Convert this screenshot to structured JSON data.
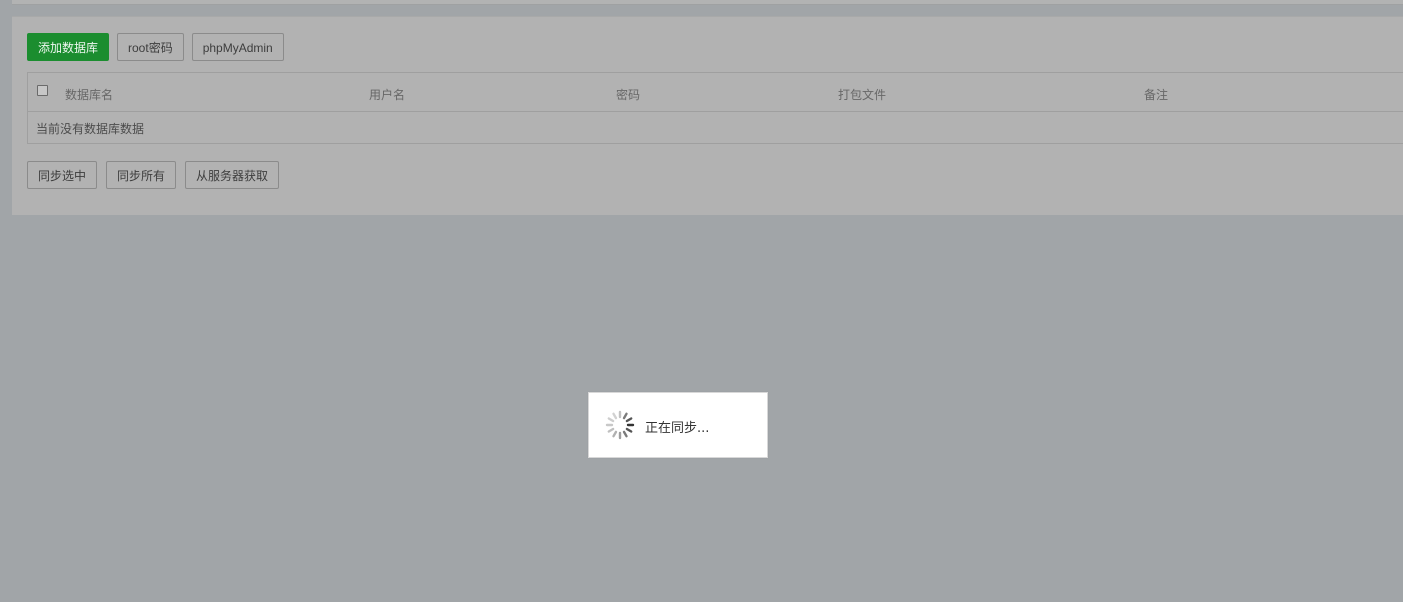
{
  "toolbar": {
    "add_database": "添加数据库",
    "root_password": "root密码",
    "phpmyadmin": "phpMyAdmin"
  },
  "table": {
    "columns": [
      "数据库名",
      "用户名",
      "密码",
      "打包文件",
      "备注"
    ],
    "empty_text": "当前没有数据库数据"
  },
  "bottom_toolbar": {
    "sync_selected": "同步选中",
    "sync_all": "同步所有",
    "fetch_from_server": "从服务器获取"
  },
  "loading": {
    "text": "正在同步...",
    "icon": "spinner-icon"
  },
  "colors": {
    "overlay_bg": "#a1a5a8",
    "panel_bg": "#b2b2b2",
    "primary_button": "#1b8d2f",
    "modal_bg": "#ffffff"
  }
}
